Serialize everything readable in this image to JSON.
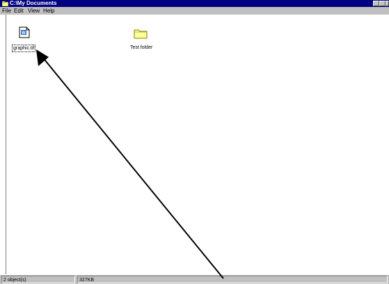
{
  "window": {
    "title": "C:\\My Documents"
  },
  "menu": [
    {
      "label": "File"
    },
    {
      "label": "Edit"
    },
    {
      "label": "View"
    },
    {
      "label": "Help"
    }
  ],
  "items": [
    {
      "label": "graphic.tif",
      "icon": "document-icon"
    },
    {
      "label": "Test folder",
      "icon": "folder-icon"
    }
  ],
  "status": {
    "objects": "2 object(s)",
    "size": "327KB"
  },
  "colors": {
    "titlebar": "#000080",
    "folder": "#ffff99"
  }
}
